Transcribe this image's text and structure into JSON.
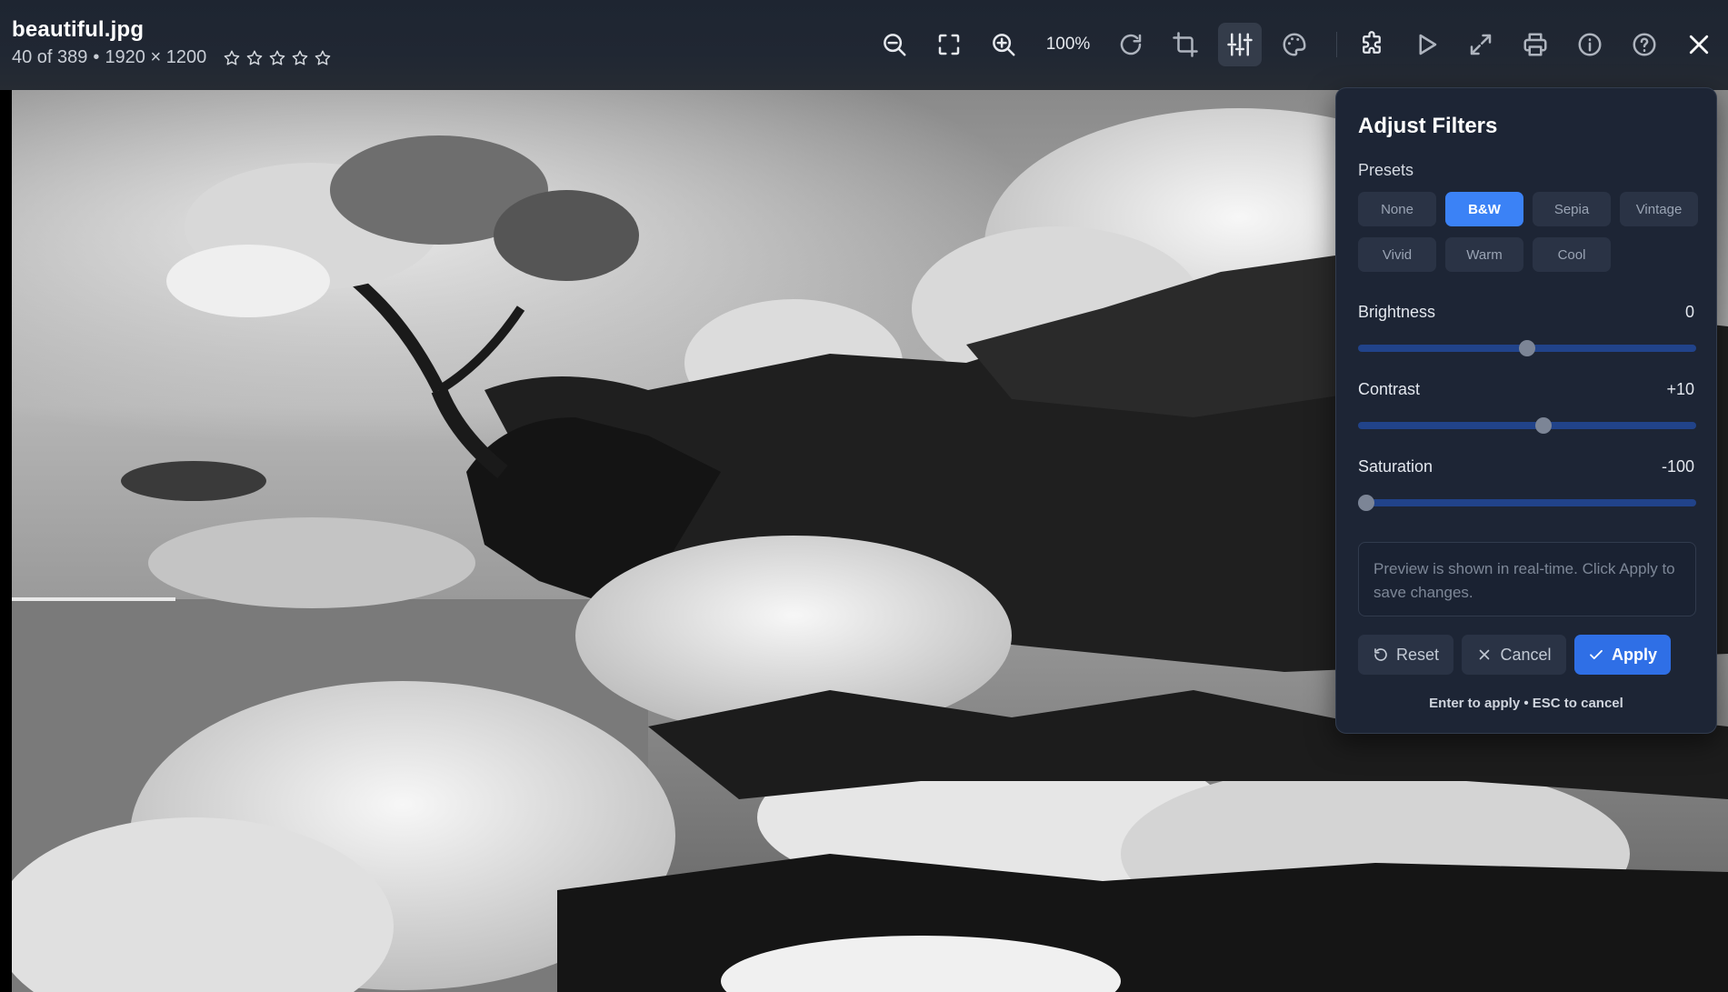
{
  "file": {
    "name": "beautiful.jpg",
    "position": "40 of 389",
    "separator": "•",
    "dimensions": "1920 × 1200",
    "rating": 0,
    "rating_max": 5
  },
  "toolbar": {
    "zoom_level": "100%",
    "buttons": [
      "zoom-out-icon",
      "fit-screen-icon",
      "zoom-in-icon",
      "rotate-icon",
      "crop-icon",
      "adjust-filters-icon",
      "palette-icon",
      "puzzle-icon",
      "slideshow-play-icon",
      "fullscreen-icon",
      "print-icon",
      "info-icon",
      "help-icon",
      "close-icon"
    ],
    "active": "adjust-filters-icon"
  },
  "panel": {
    "title": "Adjust Filters",
    "presets_label": "Presets",
    "presets": [
      "None",
      "B&W",
      "Sepia",
      "Vintage",
      "Vivid",
      "Warm",
      "Cool"
    ],
    "active_preset": "B&W",
    "brightness": {
      "label": "Brightness",
      "value_text": "0",
      "value": 0,
      "min": -100,
      "max": 100
    },
    "contrast": {
      "label": "Contrast",
      "value_text": "+10",
      "value": 10,
      "min": -100,
      "max": 100
    },
    "saturation": {
      "label": "Saturation",
      "value_text": "-100",
      "value": -100,
      "min": -100,
      "max": 100
    },
    "hint": "Preview is shown in real-time. Click Apply to save changes.",
    "reset_label": "Reset",
    "cancel_label": "Cancel",
    "apply_label": "Apply",
    "shortcut_hint": "Enter to apply • ESC to cancel"
  },
  "colors": {
    "accent": "#3b82f6",
    "panel_bg": "#1d2535",
    "topbar_bg": "#202733"
  }
}
